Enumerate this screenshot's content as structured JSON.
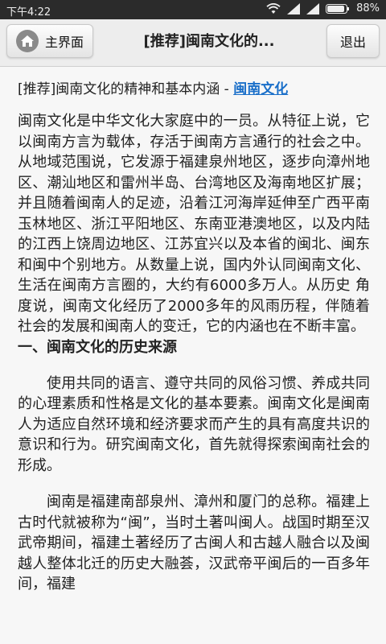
{
  "status": {
    "time": "下午4:22",
    "battery": "88%",
    "icons": [
      "wifi-icon",
      "signal-icon",
      "signal-icon",
      "battery-icon"
    ]
  },
  "toolbar": {
    "home_label": "主界面",
    "title": "[推荐]闽南文化的...",
    "exit_label": "退出"
  },
  "article": {
    "heading_text": "[推荐]闽南文化的精神和基本内涵 - ",
    "heading_link": "闽南文化",
    "intro": "闽南文化是中华文化大家庭中的一员。从特征上说，它以闽南方言为载体，存活于闽南方言通行的社会之中。从地域范围说，它发源于福建泉州地区，逐步向漳州地 区、潮汕地区和雷州半岛、台湾地区及海南地区扩展；并且随着闽南人的足迹，沿着江河海岸延伸至广西平南玉林地区、浙江平阳地区、东南亚港澳地区，以及内陆 的江西上饶周边地区、江苏宜兴以及本省的闽北、闽东和闽中个别地方。从数量上说，国内外认同闽南文化、生活在闽南方言圈的，大约有6000多万人。从历史 角度说，闽南文化经历了2000多年的风雨历程，伴随着社会的发展和闽南人的变迁，它的内涵也在不断丰富。",
    "section1_title": "一、闽南文化的历史来源",
    "p1": "使用共同的语言、遵守共同的风俗习惯、养成共同的心理素质和性格是文化的基本要素。闽南文化是闽南人为适应自然环境和经济要求而产生的具有高度共识的意识和行为。研究闽南文化，首先就得探索闽南社会的形成。",
    "p2": "闽南是福建南部泉州、漳州和厦门的总称。福建上古时代就被称为“闽”，当时土著叫闽人。战国时期至汉武帝期间，福建土著经历了古闽人和古越人融合以及闽越人整体北迁的历史大融荟，汉武帝平闽后的一百多年间，福建"
  }
}
